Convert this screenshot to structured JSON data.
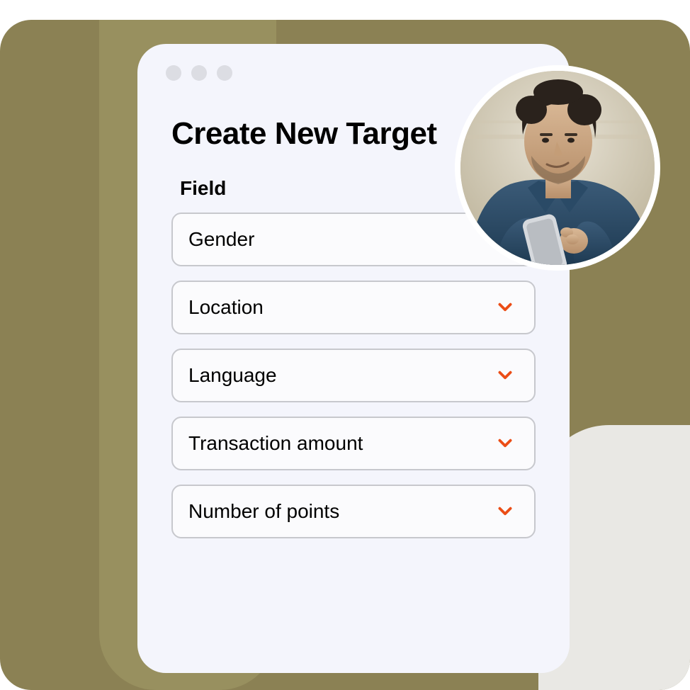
{
  "window": {
    "title": "Create New Target",
    "field_label": "Field"
  },
  "dropdowns": [
    {
      "label": "Gender"
    },
    {
      "label": "Location"
    },
    {
      "label": "Language"
    },
    {
      "label": "Transaction amount"
    },
    {
      "label": "Number of points"
    }
  ],
  "colors": {
    "accent": "#eb4d16"
  }
}
